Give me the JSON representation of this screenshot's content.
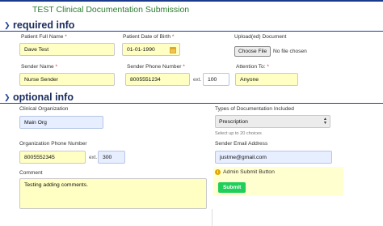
{
  "app": {
    "title": "TEST Clinical Documentation Submission"
  },
  "sections": {
    "required": "required info",
    "optional": "optional info"
  },
  "required": {
    "patient_name": {
      "label": "Patient Full Name",
      "value": "Dave Test"
    },
    "dob": {
      "label": "Patient Date of Birth",
      "value": "01-01-1990"
    },
    "upload": {
      "label": "Upload(ed) Document",
      "button": "Choose File",
      "status": "No file chosen"
    },
    "sender_name": {
      "label": "Sender Name",
      "value": "Nurse Sender"
    },
    "sender_phone": {
      "label": "Sender Phone Number",
      "value": "8005551234",
      "ext_label": "ext.",
      "ext_value": "100"
    },
    "attention": {
      "label": "Attention To:",
      "value": "Anyone"
    },
    "required_marker": "*"
  },
  "optional": {
    "clinical_org": {
      "label": "Clinical Organization",
      "value": "Main Org"
    },
    "doc_types": {
      "label": "Types of Documentation Included",
      "selected": "Prescription",
      "hint": "Select up to 20 choices"
    },
    "org_phone": {
      "label": "Organization Phone Number",
      "value": "8005552345",
      "ext_label": "ext.",
      "ext_value": "300"
    },
    "sender_email": {
      "label": "Sender Email Address",
      "value": "justme@gmail.com"
    },
    "comment": {
      "label": "Comment",
      "value": "Testing adding comments."
    },
    "admin_submit": {
      "label": "Admin Submit  Button",
      "button": "Submit"
    }
  },
  "icons": {
    "section_toggle": "chevron-down-icon",
    "date": "calendar-icon",
    "info": "info-icon",
    "select": "updown-arrows-icon"
  },
  "colors": {
    "title_green": "#2e7d32",
    "header_blue": "#1a2b5c",
    "input_yellow": "#ffffc4",
    "input_blue": "#e6eeff",
    "submit_green": "#1fcf5a",
    "required_red": "#d32f2f"
  }
}
